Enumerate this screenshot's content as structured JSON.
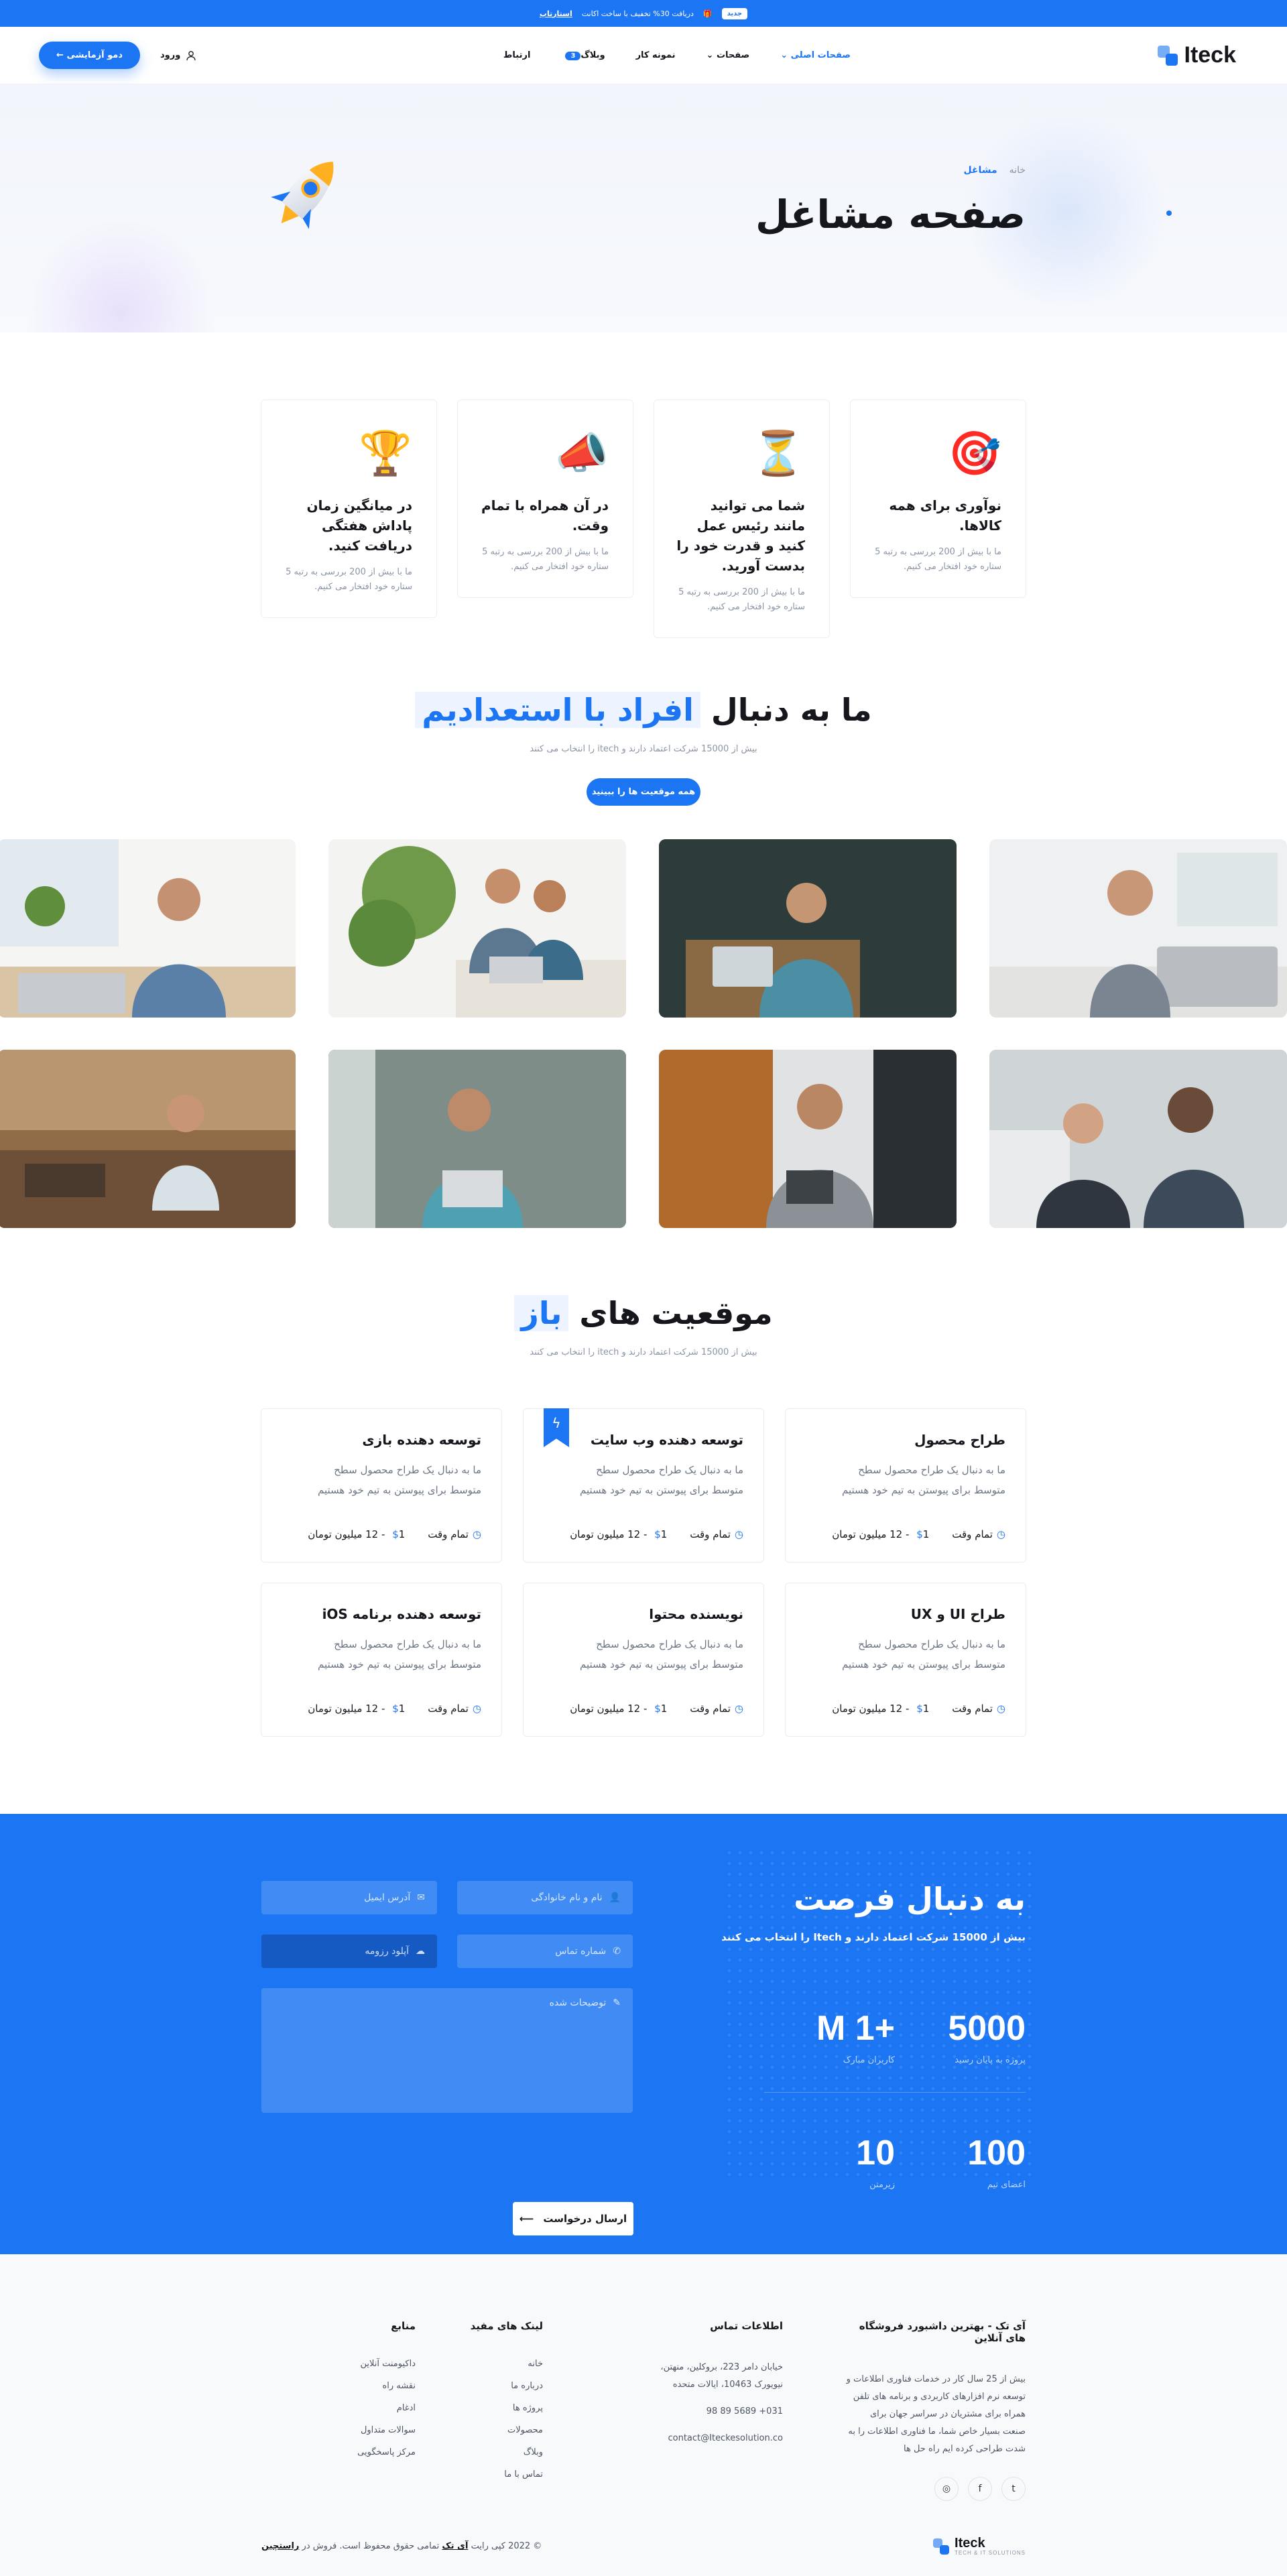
{
  "topbar": {
    "badge": "جدید",
    "text": "دریافت 30% تخفیف با ساخت اکانت",
    "link": "استارتاپ"
  },
  "header": {
    "logo": "Iteck",
    "nav": [
      {
        "label": "صفحات اصلی"
      },
      {
        "label": "صفحات"
      },
      {
        "label": "نمونه کار"
      },
      {
        "label": "وبلاگ",
        "pill": "3"
      },
      {
        "label": "ارتباط"
      }
    ],
    "login": "ورود",
    "demo": "دمو آزمایشی"
  },
  "hero": {
    "breadcrumb_home": "خانه",
    "breadcrumb_current": "مشاغل",
    "title": "صفحه مشاغل"
  },
  "features": [
    {
      "icon": "target-icon",
      "title": "نوآوری برای همه کالاها.",
      "text": "ما با بیش از 200 بررسی به رتبه 5 ستاره خود افتخار می کنیم."
    },
    {
      "icon": "hourglass-icon",
      "title": "شما می توانید مانند رئیس عمل کنید و قدرت خود را بدست آورید.",
      "text": "ما با بیش از 200 بررسی به رتبه 5 ستاره خود افتخار می کنیم."
    },
    {
      "icon": "megaphone-icon",
      "title": "در آن همراه با تمام وقت.",
      "text": "ما با بیش از 200 بررسی به رتبه 5 ستاره خود افتخار می کنیم."
    },
    {
      "icon": "trophy-icon",
      "title": "در میانگین زمان پاداش هفتگی دریافت کنید.",
      "text": "ما با بیش از 200 بررسی به رتبه 5 ستاره خود افتخار می کنیم."
    }
  ],
  "team": {
    "title_plain": "ما به دنبال",
    "title_highlight": "افراد با استعدادیم",
    "subtitle": "بیش از 15000 شرکت اعتماد دارند و itech را انتخاب می کنند",
    "button": "همه موقعیت ها را ببینید"
  },
  "positions": {
    "title_plain": "موقعیت های",
    "title_highlight": "باز",
    "subtitle": "بیش از 15000 شرکت اعتماد دارند و itech را انتخاب می کنند",
    "jobs": [
      {
        "title": "طراح محصول",
        "desc": "ما به دنبال یک طراح محصول سطح متوسط برای پیوستن به تیم خود هستیم",
        "type": "تمام وقت",
        "salary": "1 - 12 میلیون تومان",
        "featured": false
      },
      {
        "title": "توسعه دهنده وب سایت",
        "desc": "ما به دنبال یک طراح محصول سطح متوسط برای پیوستن به تیم خود هستیم",
        "type": "تمام وقت",
        "salary": "1 - 12 میلیون تومان",
        "featured": true
      },
      {
        "title": "توسعه دهنده بازی",
        "desc": "ما به دنبال یک طراح محصول سطح متوسط برای پیوستن به تیم خود هستیم",
        "type": "تمام وقت",
        "salary": "1 - 12 میلیون تومان",
        "featured": false
      },
      {
        "title": "طراح UI و UX",
        "desc": "ما به دنبال یک طراح محصول سطح متوسط برای پیوستن به تیم خود هستیم",
        "type": "تمام وقت",
        "salary": "1 - 12 میلیون تومان",
        "featured": false
      },
      {
        "title": "نویسنده محتوا",
        "desc": "ما به دنبال یک طراح محصول سطح متوسط برای پیوستن به تیم خود هستیم",
        "type": "تمام وقت",
        "salary": "1 - 12 میلیون تومان",
        "featured": false
      },
      {
        "title": "توسعه دهنده برنامه iOS",
        "desc": "ما به دنبال یک طراح محصول سطح متوسط برای پیوستن به تیم خود هستیم",
        "type": "تمام وقت",
        "salary": "1 - 12 میلیون تومان",
        "featured": false
      }
    ]
  },
  "opportunity": {
    "title": "به دنبال فرصت",
    "subtitle": "بیش از 15000 شرکت اعتماد دارند و Itech را انتخاب می کنند",
    "stats": [
      {
        "value": "5000",
        "label": "پروژه به پایان رسید"
      },
      {
        "value": "+M 1",
        "label": "کاربران مبارک"
      },
      {
        "value": "100",
        "label": "اعضای تیم"
      },
      {
        "value": "10",
        "label": "زیرمتن"
      }
    ],
    "form": {
      "name_placeholder": "نام و نام خانوادگی",
      "email_placeholder": "آدرس ایمیل",
      "phone_placeholder": "شماره تماس",
      "resume_placeholder": "آپلود رزومه",
      "message_placeholder": "توضیحات شده",
      "submit": "ارسال درخواست"
    }
  },
  "footer": {
    "about_title": "آی تک - بهترین داشبورد فروشگاه های آنلاین",
    "about_text": "بیش از 25 سال کار در خدمات فناوری اطلاعات و توسعه نرم افزارهای کاربردی و برنامه های تلفن همراه برای مشتریان در سراسر جهان برای صنعت بسیار خاص شما، ما فناوری اطلاعات را به شدت طراحی کرده ایم راه حل ها",
    "contact_title": "اطلاعات تماس",
    "address": "خیابان دامر 223، بروکلین، منهتن، نیویورک 10463، ایالات متحده",
    "phone": "031+ 5689 89 98",
    "email": "contact@Iteckesolution.co",
    "links_title": "لینک های مفید",
    "links": [
      "خانه",
      "درباره ما",
      "پروژه ها",
      "محصولات",
      "وبلاگ",
      "تماس با ما"
    ],
    "resources_title": "منابع",
    "resources": [
      "داکیومنت آنلاین",
      "نقشه راه",
      "ادغام",
      "سوالات متداول",
      "مرکز پاسخگویی"
    ],
    "copyright": "© 2022 کپی رایت",
    "brand": "آی تک",
    "rights": "تمامی حقوق محفوظ است. فروش در",
    "market": "راستچین",
    "footer_logo": "Iteck",
    "footer_logo_sub": "TECH & IT SOLUTIONS"
  }
}
